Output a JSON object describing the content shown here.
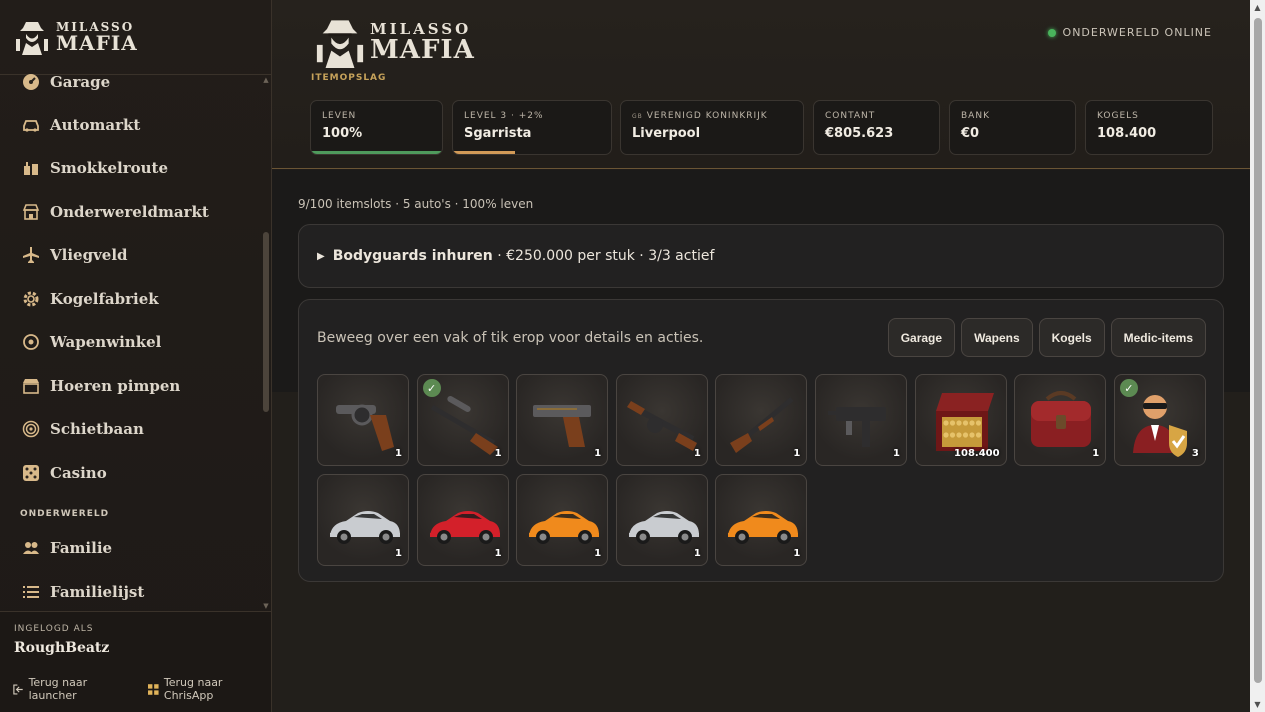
{
  "brand": {
    "small": "MILASSO",
    "big": "MAFIA"
  },
  "sidebar": {
    "items": [
      {
        "label": "Garage",
        "icon": "gauge-icon"
      },
      {
        "label": "Automarkt",
        "icon": "car-icon"
      },
      {
        "label": "Smokkelroute",
        "icon": "luggage-icon"
      },
      {
        "label": "Onderwereldmarkt",
        "icon": "market-icon"
      },
      {
        "label": "Vliegveld",
        "icon": "plane-icon"
      },
      {
        "label": "Kogelfabriek",
        "icon": "cog-icon"
      },
      {
        "label": "Wapenwinkel",
        "icon": "crosshair-icon"
      },
      {
        "label": "Hoeren pimpen",
        "icon": "store-icon"
      },
      {
        "label": "Schietbaan",
        "icon": "target-icon"
      },
      {
        "label": "Casino",
        "icon": "dice-icon"
      }
    ],
    "section": "ONDERWERELD",
    "section_items": [
      {
        "label": "Familie",
        "icon": "group-icon"
      },
      {
        "label": "Familielijst",
        "icon": "list-icon"
      }
    ],
    "footer": {
      "label": "INGELOGD ALS",
      "user": "RoughBeatz",
      "link_launcher": "Terug naar launcher",
      "link_chrisapp": "Terug naar ChrisApp"
    }
  },
  "header": {
    "subtitle": "ITEMOPSLAG",
    "status": "ONDERWERELD ONLINE",
    "status_color": "#49b35c",
    "stats": [
      {
        "label": "LEVEN",
        "value": "100%",
        "bar": 1.0,
        "bar_color": "#4f9a5c"
      },
      {
        "label": "LEVEL 3 · +2%",
        "value": "Sgarrista",
        "bar": 0.39,
        "bar_color": "#d29a57"
      },
      {
        "label": "VERENIGD KONINKRIJK",
        "flag": "GB",
        "value": "Liverpool"
      },
      {
        "label": "CONTANT",
        "value": "€805.623"
      },
      {
        "label": "BANK",
        "value": "€0"
      },
      {
        "label": "KOGELS",
        "value": "108.400"
      }
    ]
  },
  "main": {
    "summary": "9/100 itemslots · 5 auto's · 100% leven",
    "bodyguards": {
      "title": "Bodyguards inhuren",
      "details": " · €250.000 per stuk · 3/3 actief"
    },
    "inventory": {
      "hint": "Beweeg over een vak of tik erop voor details en acties.",
      "filters": [
        "Garage",
        "Wapens",
        "Kogels",
        "Medic-items"
      ],
      "items": [
        {
          "kind": "revolver-icon",
          "qty": "1",
          "equipped": false
        },
        {
          "kind": "sniper-rifle-icon",
          "qty": "1",
          "equipped": true
        },
        {
          "kind": "pistol-icon",
          "qty": "1",
          "equipped": false
        },
        {
          "kind": "tommy-gun-icon",
          "qty": "1",
          "equipped": false
        },
        {
          "kind": "shotgun-icon",
          "qty": "1",
          "equipped": false
        },
        {
          "kind": "uzi-icon",
          "qty": "1",
          "equipped": false
        },
        {
          "kind": "ammo-box-icon",
          "qty": "108.400",
          "equipped": false
        },
        {
          "kind": "medic-bag-icon",
          "qty": "1",
          "equipped": false
        },
        {
          "kind": "bodyguard-icon",
          "qty": "3",
          "equipped": true
        },
        {
          "kind": "car-silver-icon",
          "qty": "1",
          "equipped": false,
          "color": "#c9ccd0"
        },
        {
          "kind": "car-red-icon",
          "qty": "1",
          "equipped": false,
          "color": "#d3202a"
        },
        {
          "kind": "car-orange-icon",
          "qty": "1",
          "equipped": false,
          "color": "#f08a1c"
        },
        {
          "kind": "car-silver-icon",
          "qty": "1",
          "equipped": false,
          "color": "#c9ccd0"
        },
        {
          "kind": "car-orange-icon",
          "qty": "1",
          "equipped": false,
          "color": "#f08a1c"
        }
      ]
    }
  }
}
